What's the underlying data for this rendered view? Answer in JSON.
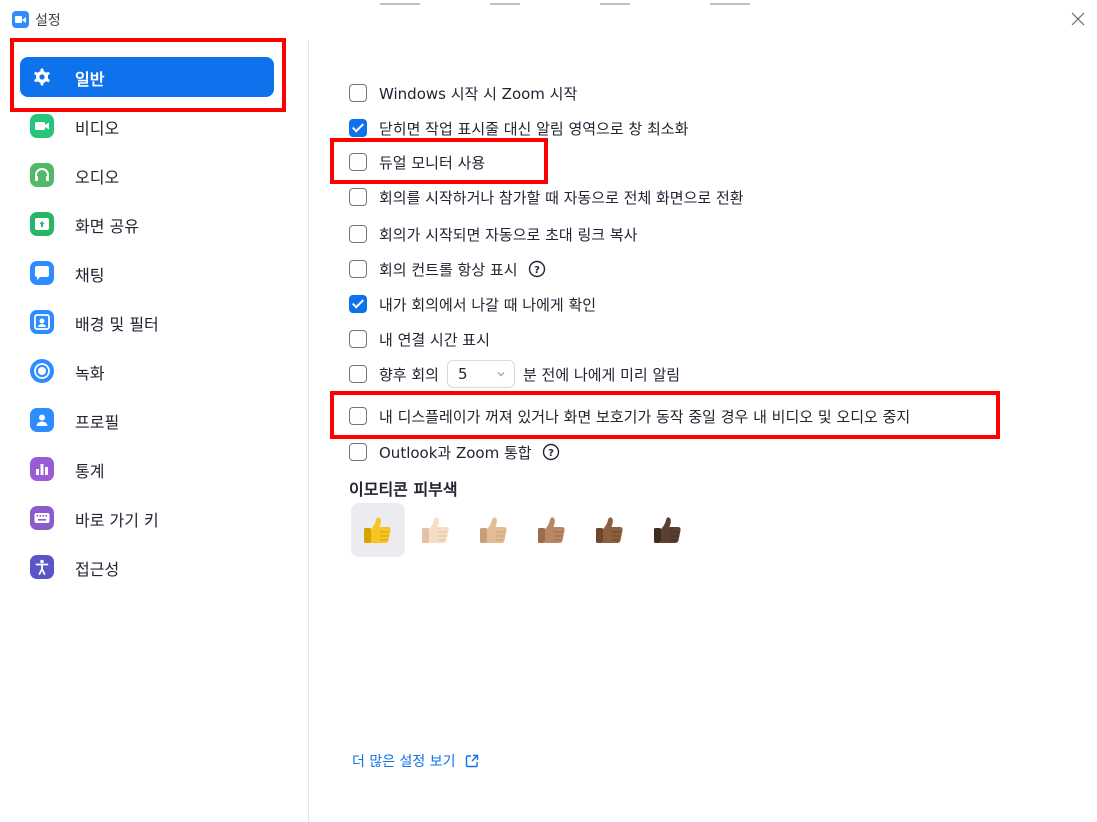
{
  "window": {
    "title": "설정"
  },
  "sidebar": {
    "items": [
      {
        "label": "일반",
        "icon": "gear-icon",
        "color": "#0E72ED",
        "active": true
      },
      {
        "label": "비디오",
        "icon": "video-camera-icon",
        "color": "#27C57B"
      },
      {
        "label": "오디오",
        "icon": "headphones-icon",
        "color": "#52B96B"
      },
      {
        "label": "화면 공유",
        "icon": "share-screen-icon",
        "color": "#28B567"
      },
      {
        "label": "채팅",
        "icon": "chat-bubble-icon",
        "color": "#2D8CFF"
      },
      {
        "label": "배경 및 필터",
        "icon": "background-person-icon",
        "color": "#2D8CFF"
      },
      {
        "label": "녹화",
        "icon": "record-icon",
        "color": "#2D8CFF"
      },
      {
        "label": "프로필",
        "icon": "profile-person-icon",
        "color": "#2D8CFF"
      },
      {
        "label": "통계",
        "icon": "bar-chart-icon",
        "color": "#9C5BD6"
      },
      {
        "label": "바로 가기 키",
        "icon": "keyboard-icon",
        "color": "#8A5CC9"
      },
      {
        "label": "접근성",
        "icon": "accessibility-person-icon",
        "color": "#5A56C8"
      }
    ]
  },
  "general": {
    "options": [
      {
        "label": "Windows 시작 시 Zoom 시작",
        "checked": false
      },
      {
        "label": "닫히면 작업 표시줄 대신 알림 영역으로 창 최소화",
        "checked": true
      },
      {
        "label": "듀얼 모니터 사용",
        "checked": false
      },
      {
        "label": "회의를 시작하거나 참가할 때 자동으로 전체 화면으로 전환",
        "checked": false
      },
      {
        "label": "회의가 시작되면 자동으로 초대 링크 복사",
        "checked": false
      },
      {
        "label": "회의 컨트롤 항상 표시",
        "checked": false,
        "help_icon": "question-circle-icon"
      },
      {
        "label": "내가 회의에서 나갈 때 나에게 확인",
        "checked": true
      },
      {
        "label": "내 연결 시간 표시",
        "checked": false
      },
      {
        "label_before": "향후 회의",
        "select_value": "5",
        "label_after": "분 전에 나에게 미리 알림",
        "checked": false
      },
      {
        "label": "내 디스플레이가 꺼져 있거나 화면 보호기가 동작 중일 경우 내 비디오 및 오디오 중지",
        "checked": false
      },
      {
        "label": "Outlook과 Zoom 통합",
        "checked": false,
        "help_icon": "question-circle-icon"
      }
    ],
    "emoji_section_title": "이모티콘 피부색",
    "skin_tones": [
      {
        "name": "thumbs-up-default-icon",
        "color": "#F7C325",
        "shade": "#D9A200",
        "selected": true
      },
      {
        "name": "thumbs-up-light-icon",
        "color": "#F6DEC4",
        "shade": "#E2C3A3"
      },
      {
        "name": "thumbs-up-medium-light-icon",
        "color": "#E2BC97",
        "shade": "#C89E77"
      },
      {
        "name": "thumbs-up-medium-icon",
        "color": "#B98763",
        "shade": "#9A6C4B"
      },
      {
        "name": "thumbs-up-medium-dark-icon",
        "color": "#8C5F3D",
        "shade": "#6E472B"
      },
      {
        "name": "thumbs-up-dark-icon",
        "color": "#5A4030",
        "shade": "#3F2C20"
      }
    ],
    "more_settings_link": "더 많은 설정 보기",
    "external_link_icon": "external-link-icon"
  },
  "theme": {
    "accent": "#0E72ED",
    "highlight": "#FF0000"
  }
}
